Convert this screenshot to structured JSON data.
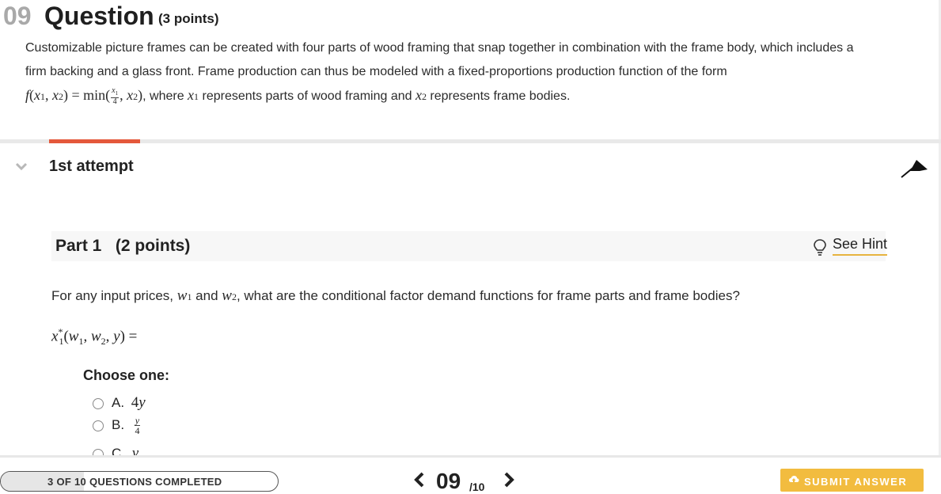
{
  "question": {
    "number": "09",
    "label": "Question",
    "points": "(3 points)",
    "stem_line1": "Customizable picture frames can be created with four parts of wood framing that snap together in combination with the frame body, which includes a",
    "stem_line2": "firm backing and a glass front. Frame production can thus be modeled with a fixed-proportions production function of the form",
    "stem_line3_text": ", where ",
    "stem_line3_x1_desc": " represents parts of wood framing and ",
    "stem_line3_x2_desc": " represents frame bodies."
  },
  "attempt": {
    "label": "1st attempt"
  },
  "part": {
    "title": "Part 1   (2 points)",
    "hint_label": "See Hint",
    "prompt_before": "For any input prices, ",
    "prompt_and": " and ",
    "prompt_after": ", what are the conditional factor demand functions for frame parts and frame bodies?",
    "choose_label": "Choose one:",
    "options": [
      {
        "letter": "A."
      },
      {
        "letter": "B."
      },
      {
        "letter": "C."
      }
    ]
  },
  "footer": {
    "progress_text": "3 OF 10 QUESTIONS COMPLETED",
    "progress_fraction": 0.3,
    "current": "09",
    "total": "/10",
    "submit_label": "SUBMIT ANSWER"
  },
  "icons": {
    "collapse": "chevron-down-icon",
    "pin": "pin-arrow-icon",
    "hint": "lightbulb-icon",
    "prev": "chevron-left-icon",
    "next": "chevron-right-icon",
    "submit": "upload-icon"
  },
  "colors": {
    "accent_tab": "#e4583b",
    "hint_underline": "#e7b43f",
    "submit_bg": "#f2bc3f"
  }
}
